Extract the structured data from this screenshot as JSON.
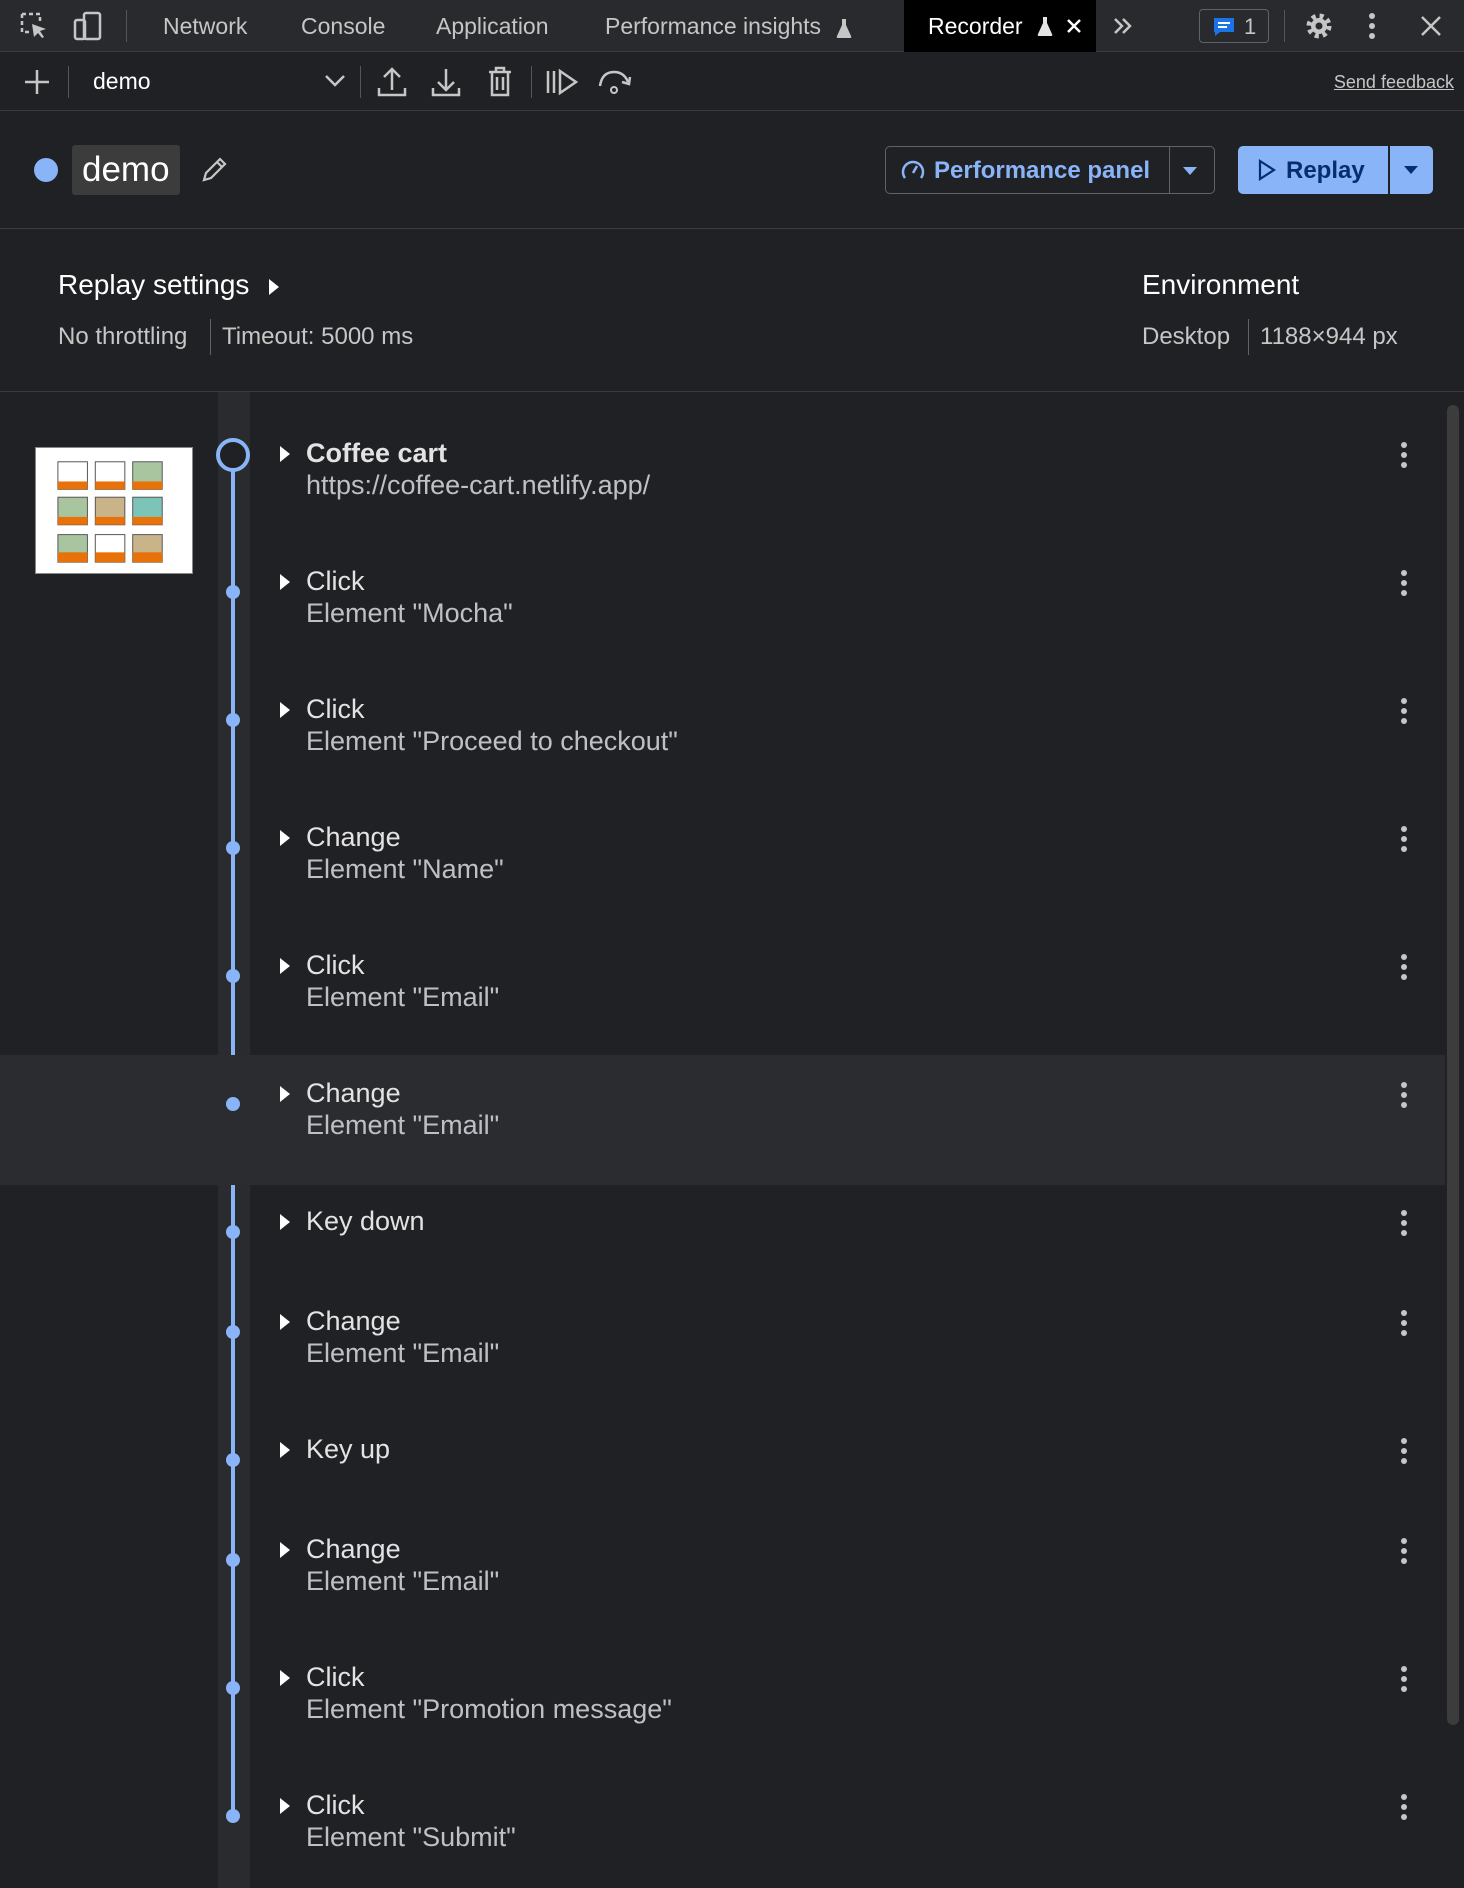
{
  "tabs": [
    "Network",
    "Console",
    "Application",
    "Performance insights",
    "Recorder"
  ],
  "issues_count": "1",
  "toolbar": {
    "recording_name": "demo",
    "feedback": "Send feedback"
  },
  "header": {
    "title": "demo",
    "performance_panel": "Performance panel",
    "replay": "Replay"
  },
  "settings": {
    "replay_title": "Replay settings",
    "throttling": "No throttling",
    "timeout": "Timeout: 5000 ms",
    "environment_title": "Environment",
    "device": "Desktop",
    "viewport": "1188×944 px"
  },
  "steps": [
    {
      "title": "Coffee cart",
      "detail": "https://coffee-cart.netlify.app/"
    },
    {
      "title": "Click",
      "detail": "Element \"Mocha\""
    },
    {
      "title": "Click",
      "detail": "Element \"Proceed to checkout\""
    },
    {
      "title": "Change",
      "detail": "Element \"Name\""
    },
    {
      "title": "Click",
      "detail": "Element \"Email\""
    },
    {
      "title": "Change",
      "detail": "Element \"Email\""
    },
    {
      "title": "Key down",
      "detail": ""
    },
    {
      "title": "Change",
      "detail": "Element \"Email\""
    },
    {
      "title": "Key up",
      "detail": ""
    },
    {
      "title": "Change",
      "detail": "Element \"Email\""
    },
    {
      "title": "Click",
      "detail": "Element \"Promotion message\""
    },
    {
      "title": "Click",
      "detail": "Element \"Submit\""
    }
  ],
  "colors": {
    "accent": "#8ab4f8",
    "background": "#202124",
    "highlight_row": "#2b2c30"
  }
}
